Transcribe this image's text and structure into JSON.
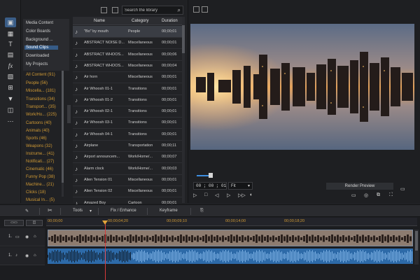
{
  "library_nav": [
    {
      "label": "Media Content"
    },
    {
      "label": "Color Boards"
    },
    {
      "label": "Background ..."
    },
    {
      "label": "Sound Clips",
      "selected": true
    },
    {
      "label": "Downloaded"
    },
    {
      "label": "My Projects"
    }
  ],
  "categories": [
    "All Content  (91)",
    "People  (56)",
    "Miscella...  (181)",
    "Transitions  (34)",
    "Transport...  (35)",
    "Work/Ho...  (225)",
    "Cartoons  (40)",
    "Animals  (40)",
    "Sports  (46)",
    "Weapons  (32)",
    "Instrume...  (41)",
    "Notificati...  (27)",
    "Cinematic  (46)",
    "Funny Pop  (38)",
    "Machine...  (21)",
    "Clicks  (18)",
    "Musical In...  (5)"
  ],
  "search": {
    "placeholder": "Search the library"
  },
  "table": {
    "headers": {
      "name": "Name",
      "category": "Category",
      "duration": "Duration"
    },
    "rows": [
      {
        "name": "\"Bo\" by mouth",
        "category": "People",
        "duration": "00;00;01"
      },
      {
        "name": "ABSTRACT NOISE D...",
        "category": "Miscellaneous",
        "duration": "00;00;01"
      },
      {
        "name": "ABSTRACT WHOOS...",
        "category": "Miscellaneous",
        "duration": "00;00;06"
      },
      {
        "name": "ABSTRACT WHOOS...",
        "category": "Miscellaneous",
        "duration": "00;00;04"
      },
      {
        "name": "Air horn",
        "category": "Miscellaneous",
        "duration": "00;00;01"
      },
      {
        "name": "Air Whoosh 01-1",
        "category": "Transitions",
        "duration": "00;00;01"
      },
      {
        "name": "Air Whoosh 01-2",
        "category": "Transitions",
        "duration": "00;00;01"
      },
      {
        "name": "Air Whoosh 02-1",
        "category": "Transitions",
        "duration": "00;00;01"
      },
      {
        "name": "Air Whoosh 03-1",
        "category": "Transitions",
        "duration": "00;00;01"
      },
      {
        "name": "Air Whoosh 04-1",
        "category": "Transitions",
        "duration": "00;00;01"
      },
      {
        "name": "Airplane",
        "category": "Transportation",
        "duration": "00;00;11"
      },
      {
        "name": "Airport announcem...",
        "category": "Work/Home/...",
        "duration": "00;00;07"
      },
      {
        "name": "Alarm clock",
        "category": "Work/Home/...",
        "duration": "00;00;03"
      },
      {
        "name": "Alien Tension 01",
        "category": "Miscellaneous",
        "duration": "00;00;01"
      },
      {
        "name": "Alien Tension 02",
        "category": "Miscellaneous",
        "duration": "00;00;01"
      },
      {
        "name": "Amazed Boy",
        "category": "Cartoon",
        "duration": "00;00;01"
      }
    ]
  },
  "preview": {
    "timecode": "00 ; 00 ; 01 ; 19",
    "fit_option": "Fit",
    "render_label": "Render Preview",
    "playhead_position": 0.18
  },
  "timeline_toolbar": {
    "tools_label": "Tools",
    "fix_label": "Fix / Enhance",
    "keyframe_label": "Keyframe"
  },
  "timeline": {
    "ruler_ticks": [
      "00;00;00",
      "00;00;04;20",
      "00;00;09;10",
      "00;00;14;00",
      "00;00;18;20"
    ],
    "tracks": [
      {
        "label": "1."
      },
      {
        "label": "1."
      }
    ]
  },
  "colors": {
    "accent": "#3d8de0",
    "category_text": "#d09a35",
    "playhead": "#d93a3a",
    "selection": "#365b86"
  }
}
